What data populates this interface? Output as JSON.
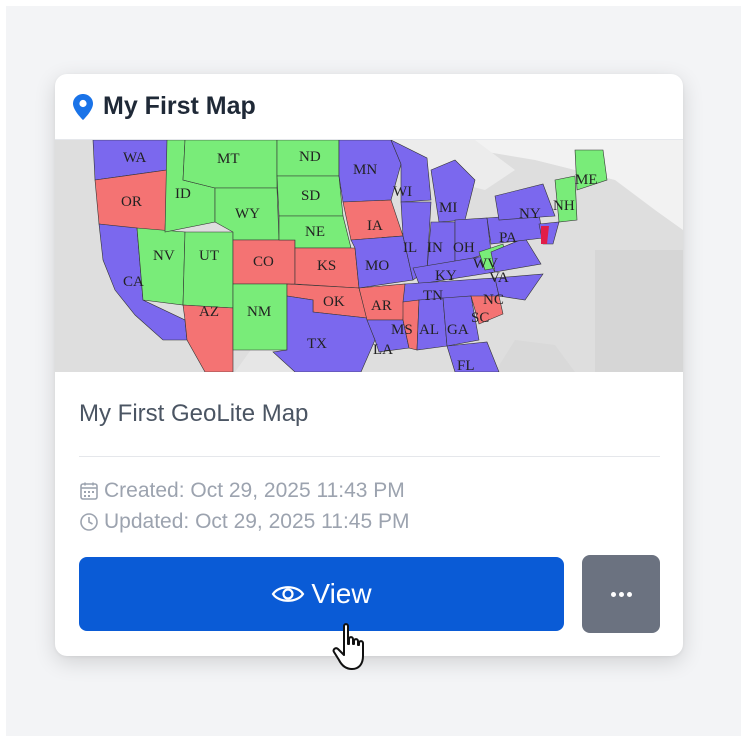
{
  "card": {
    "title": "My First Map",
    "description": "My First GeoLite Map",
    "created": "Created: Oct 29, 2025 11:43 PM",
    "updated": "Updated: Oct 29, 2025 11:45 PM"
  },
  "actions": {
    "view_label": "View"
  },
  "icons": {
    "title": "map-pin-icon",
    "created": "calendar-icon",
    "updated": "clock-icon",
    "view": "eye-icon",
    "more": "ellipsis-icon",
    "cursor": "hand-pointer-icon"
  },
  "colors": {
    "primary": "#0a5bd6",
    "secondary": "#6b7280",
    "red_states": "#f47373",
    "green_states": "#79ec79",
    "blue_states": "#7b68ee"
  },
  "map": {
    "red": [
      "OR",
      "CO",
      "KS",
      "AZ",
      "OK",
      "AR",
      "MS",
      "IA",
      "SC"
    ],
    "green": [
      "MT",
      "ND",
      "SD",
      "ID",
      "WY",
      "NE",
      "NV",
      "UT",
      "NM",
      "WV",
      "ME",
      "NH"
    ],
    "blue": [
      "WA",
      "CA",
      "TX",
      "MN",
      "WI",
      "MI",
      "IL",
      "IN",
      "OH",
      "NY",
      "PA",
      "MO",
      "KY",
      "VA",
      "TN",
      "NC",
      "LA",
      "AL",
      "GA",
      "FL"
    ],
    "labels": [
      "WA",
      "MT",
      "ND",
      "MN",
      "ME",
      "OR",
      "ID",
      "SD",
      "WI",
      "MI",
      "NY",
      "NH",
      "WY",
      "NE",
      "IA",
      "IL",
      "IN",
      "OH",
      "PA",
      "NV",
      "UT",
      "CO",
      "KS",
      "MO",
      "KY",
      "WV",
      "VA",
      "CA",
      "AZ",
      "NM",
      "OK",
      "AR",
      "TN",
      "NC",
      "SC",
      "MS",
      "AL",
      "GA",
      "TX",
      "LA",
      "FL"
    ]
  }
}
